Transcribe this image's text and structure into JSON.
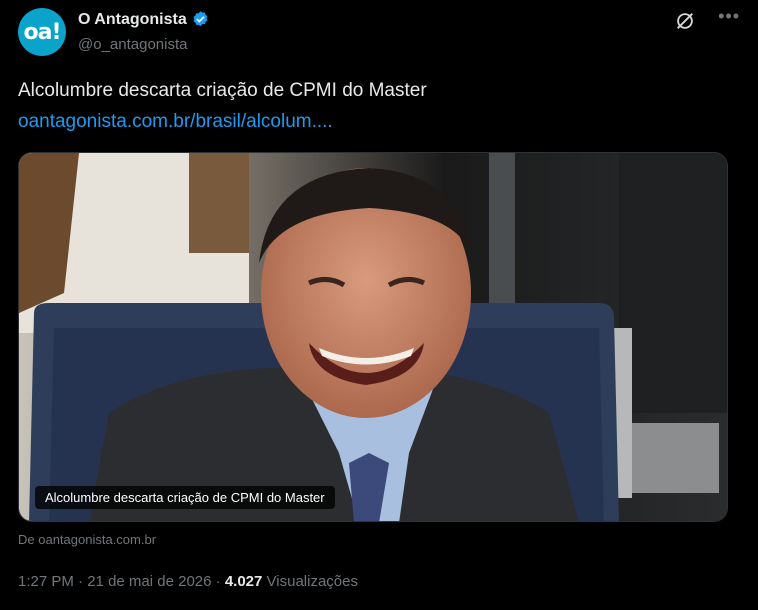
{
  "account": {
    "avatar_text": "oa!",
    "display_name": "O Antagonista",
    "handle": "@o_antagonista"
  },
  "post": {
    "text": "Alcolumbre descarta criação de CPMI do Master",
    "link": "oantagonista.com.br/brasil/alcolum...."
  },
  "card": {
    "caption": "Alcolumbre descarta criação de CPMI do Master",
    "source": "De oantagonista.com.br"
  },
  "meta": {
    "time": "1:27 PM",
    "sep1": " · ",
    "date": "21 de mai de 2026",
    "sep2": " · ",
    "views_count": "4.027",
    "views_label": " Visualizações"
  },
  "icons": {
    "verified": "verified-badge-icon",
    "grok": "grok-icon",
    "more": "more-icon"
  },
  "colors": {
    "accent": "#1d9bf0",
    "avatar": "#0aa3c9",
    "background": "#000000",
    "muted": "#71767b"
  }
}
